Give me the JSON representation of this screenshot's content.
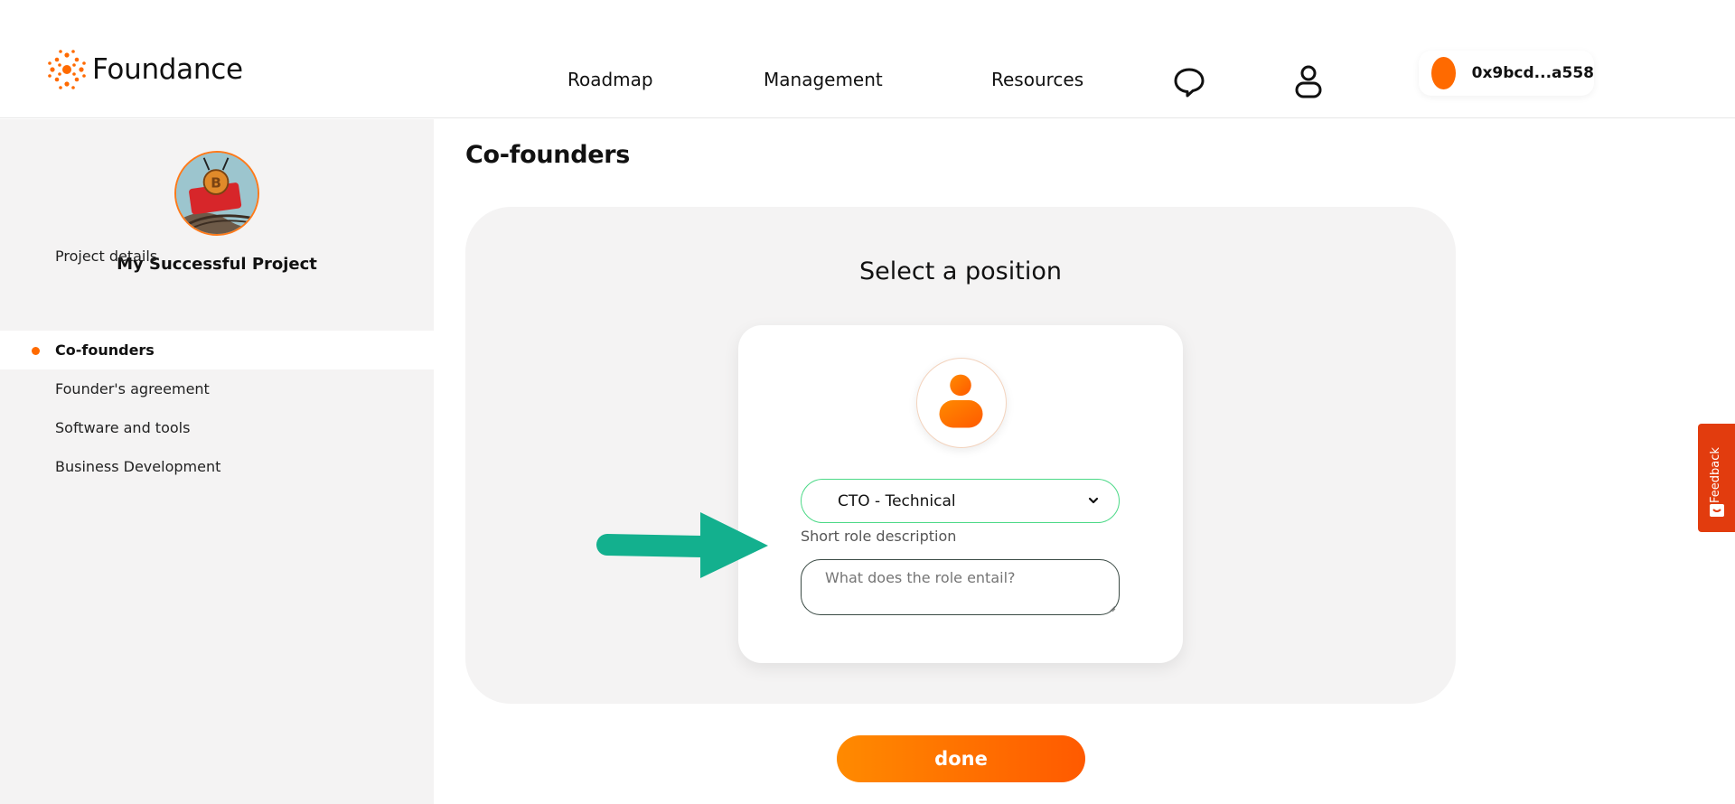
{
  "header": {
    "brand": "Foundance",
    "nav": [
      {
        "label": "Roadmap"
      },
      {
        "label": "Management"
      },
      {
        "label": "Resources"
      }
    ],
    "wallet_address": "0x9bcd...a558"
  },
  "sidebar": {
    "project_name": "My Successful Project",
    "items": [
      {
        "label": "Project details",
        "active": false
      },
      {
        "label": "Co-founders",
        "active": true
      },
      {
        "label": "Founder's agreement",
        "active": false
      },
      {
        "label": "Software and tools",
        "active": false
      },
      {
        "label": "Business Development",
        "active": false
      }
    ]
  },
  "main": {
    "page_title": "Co-founders",
    "panel_title": "Select a position",
    "position_select_value": "CTO - Technical",
    "role_description_label": "Short role description",
    "role_description_placeholder": "What does the role entail?",
    "done_label": "done"
  },
  "feedback_label": "Feedback",
  "colors": {
    "accent": "#ff6a00",
    "select_border": "#4cd987",
    "arrow": "#13b08e",
    "feedback_tab": "#e23c0e"
  }
}
